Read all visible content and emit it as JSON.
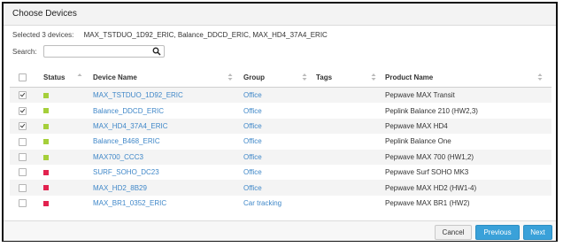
{
  "dialog": {
    "title": "Choose Devices"
  },
  "selection": {
    "label": "Selected 3 devices:",
    "list": "MAX_TSTDUO_1D92_ERIC, Balance_DDCD_ERIC, MAX_HD4_37A4_ERIC"
  },
  "search": {
    "label": "Search:",
    "value": "",
    "placeholder": ""
  },
  "table": {
    "headers": {
      "status": "Status",
      "device_name": "Device Name",
      "group": "Group",
      "tags": "Tags",
      "product_name": "Product Name"
    },
    "rows": [
      {
        "checked": true,
        "status": "online",
        "device_name": "MAX_TSTDUO_1D92_ERIC",
        "group": "Office",
        "tags": "",
        "product_name": "Pepwave MAX Transit"
      },
      {
        "checked": true,
        "status": "online",
        "device_name": "Balance_DDCD_ERIC",
        "group": "Office",
        "tags": "",
        "product_name": "Peplink Balance 210 (HW2,3)"
      },
      {
        "checked": true,
        "status": "online",
        "device_name": "MAX_HD4_37A4_ERIC",
        "group": "Office",
        "tags": "",
        "product_name": "Pepwave MAX HD4"
      },
      {
        "checked": false,
        "status": "online",
        "device_name": "Balance_B468_ERIC",
        "group": "Office",
        "tags": "",
        "product_name": "Peplink Balance One"
      },
      {
        "checked": false,
        "status": "online",
        "device_name": "MAX700_CCC3",
        "group": "Office",
        "tags": "",
        "product_name": "Pepwave MAX 700 (HW1,2)"
      },
      {
        "checked": false,
        "status": "offline",
        "device_name": "SURF_SOHO_DC23",
        "group": "Office",
        "tags": "",
        "product_name": "Pepwave Surf SOHO MK3"
      },
      {
        "checked": false,
        "status": "offline",
        "device_name": "MAX_HD2_8B29",
        "group": "Office",
        "tags": "",
        "product_name": "Pepwave MAX HD2 (HW1-4)"
      },
      {
        "checked": false,
        "status": "offline",
        "device_name": "MAX_BR1_0352_ERIC",
        "group": "Car tracking",
        "tags": "",
        "product_name": "Pepwave MAX BR1 (HW2)"
      }
    ]
  },
  "buttons": {
    "cancel": "Cancel",
    "previous": "Previous",
    "next": "Next"
  },
  "colors": {
    "online": "#a5cf3a",
    "offline": "#e2224f",
    "link": "#3f87c8",
    "primary_button": "#3aa1d9"
  },
  "icons": {
    "search": "magnifier-icon",
    "sort": "sort-arrows-icon"
  }
}
